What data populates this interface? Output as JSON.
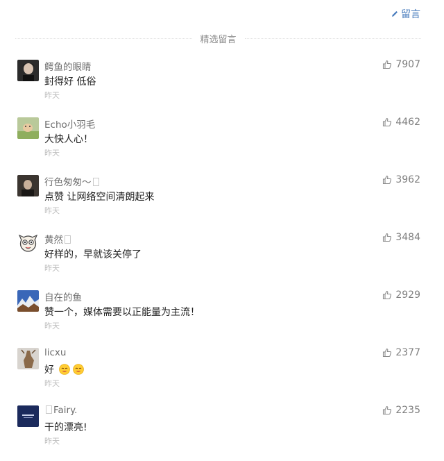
{
  "header": {
    "write_label": "留言"
  },
  "section": {
    "title": "精选留言"
  },
  "comments": [
    {
      "nickname": "鳄鱼的眼睛",
      "content": "封得好  低俗",
      "time": "昨天",
      "likes": "7907"
    },
    {
      "nickname": "Echo小羽毛",
      "content": "大快人心！",
      "time": "昨天",
      "likes": "4462"
    },
    {
      "nickname": "行色匆匆～",
      "content": "点赞 让网络空间清朗起来",
      "time": "昨天",
      "likes": "3962"
    },
    {
      "nickname": "黄然",
      "content": "好样的，早就该关停了",
      "time": "昨天",
      "likes": "3484"
    },
    {
      "nickname": "自在的鱼",
      "content": "赞一个，媒体需要以正能量为主流！",
      "time": "昨天",
      "likes": "2929"
    },
    {
      "nickname": "licxu",
      "content": "好",
      "time": "昨天",
      "likes": "2377"
    },
    {
      "nickname": "Fairy.",
      "content": "干的漂亮!",
      "time": "昨天",
      "likes": "2235"
    }
  ],
  "icons": {
    "write": "pencil-icon",
    "like": "thumbs-up-icon",
    "accent": "#4a7dbd"
  }
}
